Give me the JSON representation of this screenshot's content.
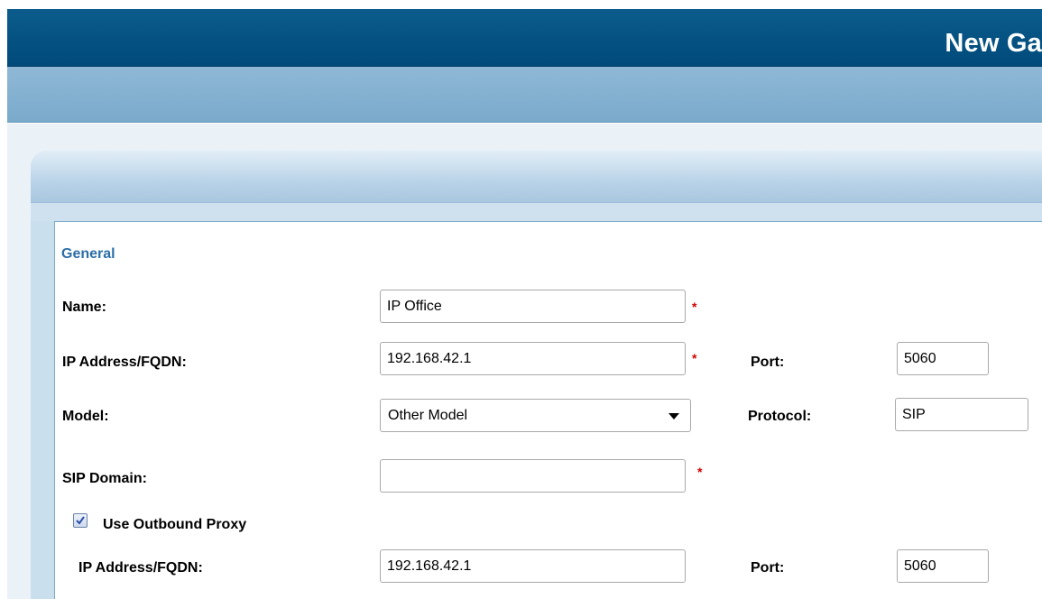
{
  "header": {
    "title": "New Ga"
  },
  "form": {
    "section_title": "General",
    "name": {
      "label": "Name:",
      "value": "IP Office",
      "required": "*"
    },
    "ip_address": {
      "label": "IP Address/FQDN:",
      "value": "192.168.42.1",
      "required": "*"
    },
    "port": {
      "label": "Port:",
      "value": "5060"
    },
    "model": {
      "label": "Model:",
      "value": "Other Model"
    },
    "protocol": {
      "label": "Protocol:",
      "value": "SIP"
    },
    "sip_domain": {
      "label": "SIP Domain:",
      "value": "",
      "required": "*"
    },
    "outbound_proxy": {
      "label": "Use Outbound Proxy",
      "checked": true
    },
    "proxy_ip": {
      "label": "IP Address/FQDN:",
      "value": "192.168.42.1"
    },
    "proxy_port": {
      "label": "Port:",
      "value": "5060"
    }
  },
  "colors": {
    "title_bar": "#0b5c8c",
    "sub_bar": "#7aaacb",
    "section_title": "#2e6ea8",
    "required_marker": "#d40000"
  }
}
